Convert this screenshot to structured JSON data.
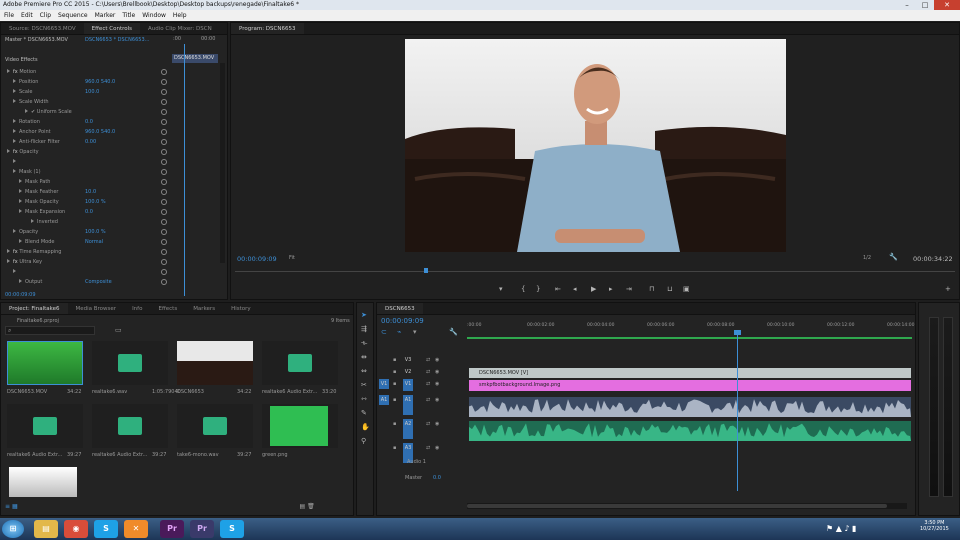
{
  "window": {
    "title": "Adobe Premiere Pro CC 2015 - C:\\Users\\Brellbook\\Desktop\\Desktop backups\\renegade\\Finaltake6 *"
  },
  "menu": [
    "File",
    "Edit",
    "Clip",
    "Sequence",
    "Marker",
    "Title",
    "Window",
    "Help"
  ],
  "source_panel": {
    "tabs": [
      "Source: DSCN6653.MOV",
      "Effect Controls",
      "Audio Clip Mixer: DSCN"
    ],
    "master": "Master * DSCN6653.MOV",
    "clip": "DSCN6653 * DSCN6653...",
    "clip_label": "DSCN6653.MOV",
    "time_start": ":00",
    "time_end": "00:00"
  },
  "effects": {
    "header": "Video Effects",
    "rows": [
      {
        "label": "Motion",
        "value": "",
        "indent": 1,
        "fx": true
      },
      {
        "label": "Position",
        "value": "960.0    540.0",
        "indent": 2
      },
      {
        "label": "Scale",
        "value": "100.0",
        "indent": 2
      },
      {
        "label": "Scale Width",
        "value": "",
        "indent": 2
      },
      {
        "label": "✔ Uniform Scale",
        "value": "",
        "indent": 4
      },
      {
        "label": "Rotation",
        "value": "0.0",
        "indent": 2
      },
      {
        "label": "Anchor Point",
        "value": "960.0    540.0",
        "indent": 2
      },
      {
        "label": "Anti-flicker Filter",
        "value": "0.00",
        "indent": 2
      },
      {
        "label": "Opacity",
        "value": "",
        "indent": 1,
        "fx": true
      },
      {
        "label": "",
        "value": "",
        "indent": 2
      },
      {
        "label": "Mask (1)",
        "value": "",
        "indent": 2
      },
      {
        "label": "Mask Path",
        "value": "",
        "indent": 3
      },
      {
        "label": "Mask Feather",
        "value": "10.0",
        "indent": 3
      },
      {
        "label": "Mask Opacity",
        "value": "100.0 %",
        "indent": 3
      },
      {
        "label": "Mask Expansion",
        "value": "0.0",
        "indent": 3
      },
      {
        "label": "Inverted",
        "value": "",
        "indent": 5
      },
      {
        "label": "Opacity",
        "value": "100.0 %",
        "indent": 2
      },
      {
        "label": "Blend Mode",
        "value": "Normal",
        "indent": 3
      },
      {
        "label": "Time Remapping",
        "value": "",
        "indent": 1,
        "fx": true
      },
      {
        "label": "Ultra Key",
        "value": "",
        "indent": 1,
        "fx": true
      },
      {
        "label": "",
        "value": "",
        "indent": 2
      },
      {
        "label": "Output",
        "value": "Composite",
        "indent": 3
      }
    ],
    "timecode": "00:00:09:09"
  },
  "program": {
    "title": "Program: DSCN6653",
    "timecode": "00:00:09:09",
    "fit": "Fit",
    "ratio": "1/2",
    "duration": "00:00:34:22"
  },
  "project": {
    "tabs": [
      "Project: Finaltake6",
      "Media Browser",
      "Info",
      "Effects",
      "Markers",
      "History"
    ],
    "file": "Finaltake6.prproj",
    "count": "9 Items",
    "items": [
      {
        "name": "DSCN6653.MOV",
        "dur": "34:22",
        "kind": "green"
      },
      {
        "name": "realtake6.wav",
        "dur": "1:05:79040",
        "kind": "wav"
      },
      {
        "name": "DSCN6653",
        "dur": "34:22",
        "kind": "video"
      },
      {
        "name": "realtake6 Audio Extr...",
        "dur": "33:20",
        "kind": "wav"
      },
      {
        "name": "realtake6 Audio Extr...",
        "dur": "39:27",
        "kind": "wav"
      },
      {
        "name": "realtake6 Audio Extr...",
        "dur": "39:27",
        "kind": "wav"
      },
      {
        "name": "take6-mono.wav",
        "dur": "39:27",
        "kind": "wav"
      },
      {
        "name": "green.png",
        "dur": "",
        "kind": "greenpng"
      }
    ]
  },
  "timeline": {
    "title": "DSCN6653",
    "timecode": "00:00:09:09",
    "ruler": [
      ":00:00",
      "00:00:02:00",
      "00:00:04:00",
      "00:00:06:00",
      "00:00:08:00",
      "00:00:10:00",
      "00:00:12:00",
      "00:00:14:00"
    ],
    "tracks": [
      {
        "src": "",
        "name": "V3"
      },
      {
        "src": "",
        "name": "V2"
      },
      {
        "src": "V1",
        "name": "V1"
      },
      {
        "src": "A1",
        "name": "A1"
      },
      {
        "src": "",
        "name": "A2"
      },
      {
        "src": "",
        "name": "A3"
      }
    ],
    "clips": {
      "v2": "DSCN6653.MOV [V]",
      "v1": "smkpfbotbackground.Image.png"
    },
    "audio_label": "Audio 1",
    "master": "Master",
    "master_val": "0.0"
  },
  "tray": {
    "time": "3:50 PM",
    "date": "10/27/2015"
  },
  "colors": {
    "accent": "#3d8fd6",
    "clip_v2": "#bfc8c8",
    "clip_v1": "#e46ee0",
    "audio": "#38b686",
    "audio_bg": "#3b4a63"
  }
}
